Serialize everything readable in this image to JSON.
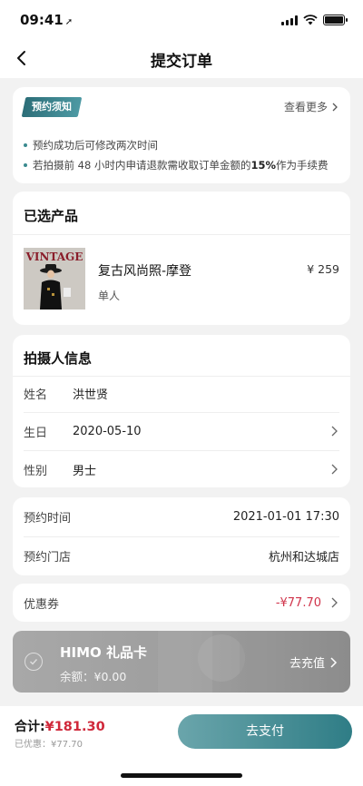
{
  "status_bar": {
    "time": "09:41"
  },
  "nav": {
    "title": "提交订单"
  },
  "notice": {
    "badge": "预约须知",
    "see_more": "查看更多",
    "line1": "预约成功后可修改两次时间",
    "line2_prefix": "若拍摄前 48 小时内申请退款需收取订单金额的 ",
    "line2_highlight": "15%",
    "line2_suffix": " 作为手续费"
  },
  "product": {
    "section_title": "已选产品",
    "image_text": "VINTAGE",
    "name": "复古风尚照-摩登",
    "price": "¥ 259",
    "subtitle": "单人"
  },
  "person": {
    "section_title": "拍摄人信息",
    "rows": [
      {
        "label": "姓名",
        "value": "洪世贤"
      },
      {
        "label": "生日",
        "value": "2020-05-10"
      },
      {
        "label": "性别",
        "value": "男士"
      }
    ]
  },
  "booking": {
    "time_label": "预约时间",
    "time_value": "2021-01-01 17:30",
    "store_label": "预约门店",
    "store_value": "杭州和达城店"
  },
  "coupon": {
    "label": "优惠券",
    "value": "-¥77.70",
    "value_color": "#d0334a"
  },
  "giftcard": {
    "title": "HIMO 礼品卡",
    "balance": "余额：¥0.00",
    "recharge": "去充值"
  },
  "footer": {
    "total_label": "合计:",
    "total_amount": "¥181.30",
    "saved": "已优惠：¥77.70",
    "pay_button": "去支付"
  },
  "colors": {
    "accent": "#2f7d86",
    "price_red": "#d0283a"
  }
}
